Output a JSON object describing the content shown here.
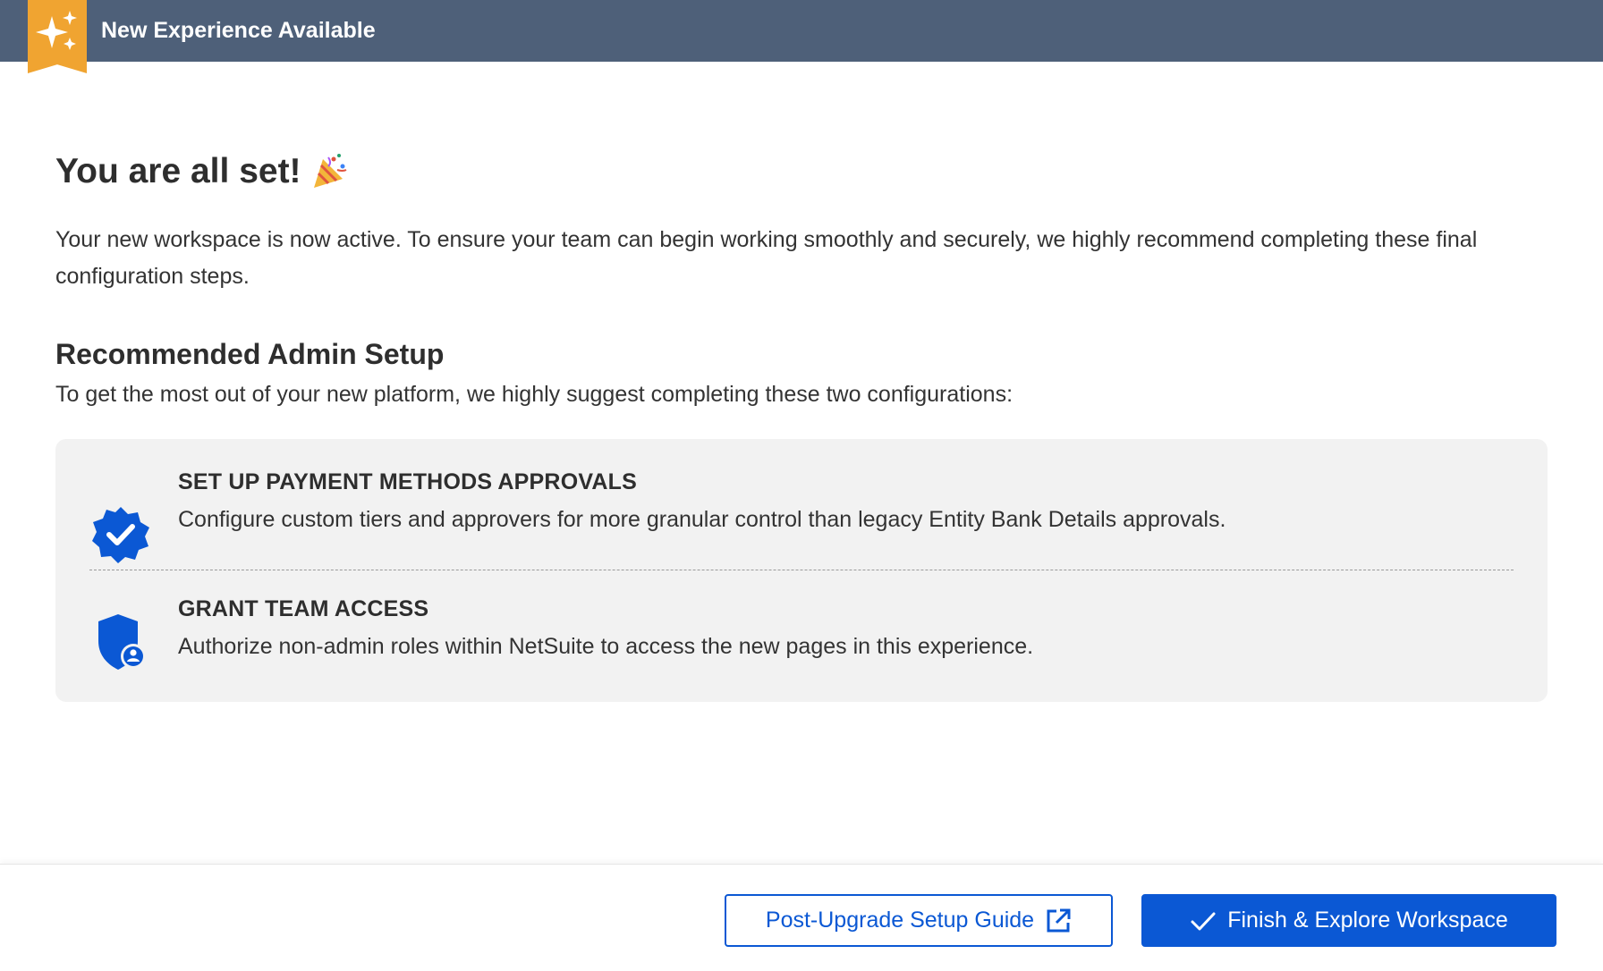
{
  "header": {
    "title": "New Experience Available",
    "badge_icon": "sparkles-icon",
    "background_color": "#4e6079",
    "badge_color": "#f0a431"
  },
  "main": {
    "title": "You are all set!",
    "title_icon": "party-popper-icon",
    "intro": "Your new workspace is now active. To ensure your team can begin working smoothly and securely, we highly recommend completing these final configuration steps.",
    "section_title": "Recommended Admin Setup",
    "section_subtitle": "To get the most out of your new platform, we highly suggest completing these two configurations:",
    "steps": [
      {
        "icon": "verified-badge-icon",
        "title": "SET UP PAYMENT METHODS APPROVALS",
        "description": "Configure custom tiers and approvers for more granular control than legacy Entity Bank Details approvals."
      },
      {
        "icon": "shield-user-icon",
        "title": "GRANT TEAM ACCESS",
        "description": "Authorize non-admin roles within NetSuite to access the new pages in this experience."
      }
    ]
  },
  "footer": {
    "guide_button": "Post-Upgrade Setup Guide",
    "guide_icon": "external-link-icon",
    "finish_button": "Finish & Explore Workspace",
    "finish_icon": "checkmark-icon",
    "accent_color": "#0b58d4"
  }
}
